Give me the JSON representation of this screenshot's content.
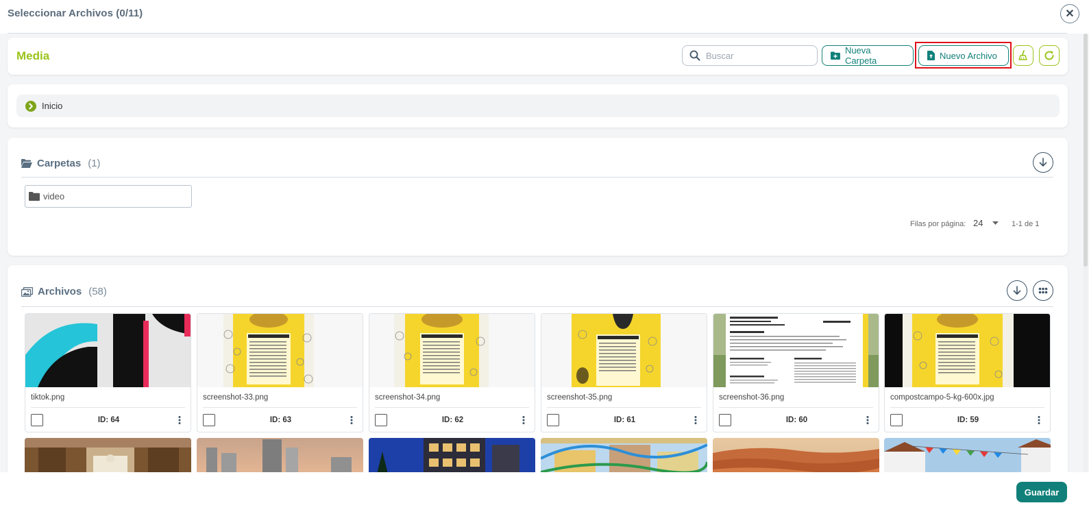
{
  "dialog": {
    "title": "Seleccionar Archivos (0/11)"
  },
  "toolbar": {
    "section_title": "Media",
    "search_placeholder": "Buscar",
    "new_folder_label": "Nueva Carpeta",
    "new_file_label": "Nuevo Archivo"
  },
  "breadcrumb": {
    "items": [
      "Inicio"
    ]
  },
  "folders": {
    "title": "Carpetas",
    "count": "(1)",
    "items": [
      {
        "name": "video"
      }
    ],
    "pagination": {
      "rows_label": "Filas por página:",
      "rows_value": "24",
      "range": "1-1 de 1"
    }
  },
  "files": {
    "title": "Archivos",
    "count": "(58)",
    "items": [
      {
        "name": "tiktok.png",
        "id": "ID: 64"
      },
      {
        "name": "screenshot-33.png",
        "id": "ID: 63"
      },
      {
        "name": "screenshot-34.png",
        "id": "ID: 62"
      },
      {
        "name": "screenshot-35.png",
        "id": "ID: 61"
      },
      {
        "name": "screenshot-36.png",
        "id": "ID: 60"
      },
      {
        "name": "compostcampo-5-kg-600x.jpg",
        "id": "ID: 59"
      }
    ]
  },
  "footer": {
    "save_label": "Guardar"
  },
  "colors": {
    "accent_green": "#9ac41b",
    "teal": "#12807a",
    "highlight_red": "#e0101a"
  }
}
